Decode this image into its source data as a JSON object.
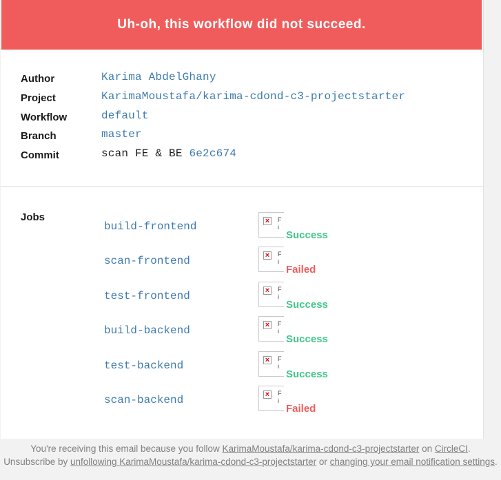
{
  "banner": {
    "title": "Uh-oh, this workflow did not succeed."
  },
  "meta": {
    "author_label": "Author",
    "author_value": "Karima AbdelGhany",
    "project_label": "Project",
    "project_value": "KarimaMoustafa/karima-cdond-c3-projectstarter",
    "workflow_label": "Workflow",
    "workflow_value": "default",
    "branch_label": "Branch",
    "branch_value": "master",
    "commit_label": "Commit",
    "commit_message": "scan FE & BE",
    "commit_hash": "6e2c674"
  },
  "jobs": {
    "label": "Jobs",
    "items": [
      {
        "name": "build-frontend",
        "status": "Success"
      },
      {
        "name": "scan-frontend",
        "status": "Failed"
      },
      {
        "name": "test-frontend",
        "status": "Success"
      },
      {
        "name": "build-backend",
        "status": "Success"
      },
      {
        "name": "test-backend",
        "status": "Success"
      },
      {
        "name": "scan-backend",
        "status": "Failed"
      }
    ],
    "image_alt_text": "F\ni"
  },
  "footer": {
    "line1_prefix": "You're receiving this email because you follow ",
    "project_link": "KarimaMoustafa/karima-cdond-c3-projectstarter",
    "line1_mid": " on ",
    "circleci_link": "CircleCI",
    "line1_suffix": ".",
    "line2_prefix": "Unsubscribe by ",
    "unfollow_link": "unfollowing KarimaMoustafa/karima-cdond-c3-projectstarter",
    "line2_mid": " or ",
    "settings_link": "changing your email notification settings",
    "line2_suffix": "."
  },
  "colors": {
    "banner_bg": "#f05c5c",
    "link": "#3d7ab0",
    "success": "#42c88a",
    "failed": "#ef5c5c"
  }
}
